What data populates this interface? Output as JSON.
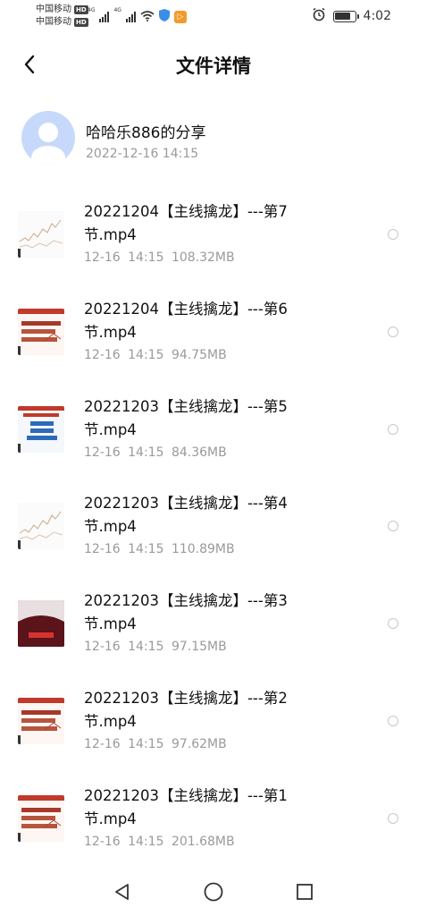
{
  "status_bar": {
    "carrier1": "中国移动",
    "carrier2": "中国移动",
    "hd": "HD",
    "net1": "4G",
    "net2": "4G",
    "time": "4:02"
  },
  "header": {
    "title": "文件详情",
    "back_icon": "chevron-left-icon"
  },
  "sharer": {
    "name": "哈哈乐886的分享",
    "date": "2022-12-16  14:15"
  },
  "files": [
    {
      "name": "20221204【主线擒龙】---第7节.mp4",
      "time": "12-16 14:15",
      "size": "108.32MB",
      "thumb": "chart"
    },
    {
      "name": "20221204【主线擒龙】---第6节.mp4",
      "time": "12-16 14:15",
      "size": "94.75MB",
      "thumb": "slide-red"
    },
    {
      "name": "20221203【主线擒龙】---第5节.mp4",
      "time": "12-16 14:15",
      "size": "84.36MB",
      "thumb": "slide-blue"
    },
    {
      "name": "20221203【主线擒龙】---第4节.mp4",
      "time": "12-16 14:15",
      "size": "110.89MB",
      "thumb": "chart"
    },
    {
      "name": "20221203【主线擒龙】---第3节.mp4",
      "time": "12-16 14:15",
      "size": "97.15MB",
      "thumb": "dark"
    },
    {
      "name": "20221203【主线擒龙】---第2节.mp4",
      "time": "12-16 14:15",
      "size": "97.62MB",
      "thumb": "slide-red"
    },
    {
      "name": "20221203【主线擒龙】---第1节.mp4",
      "time": "12-16 14:15",
      "size": "201.68MB",
      "thumb": "slide-red"
    }
  ],
  "nav": {
    "back": "triangle-back-icon",
    "home": "circle-home-icon",
    "recents": "square-recents-icon"
  }
}
